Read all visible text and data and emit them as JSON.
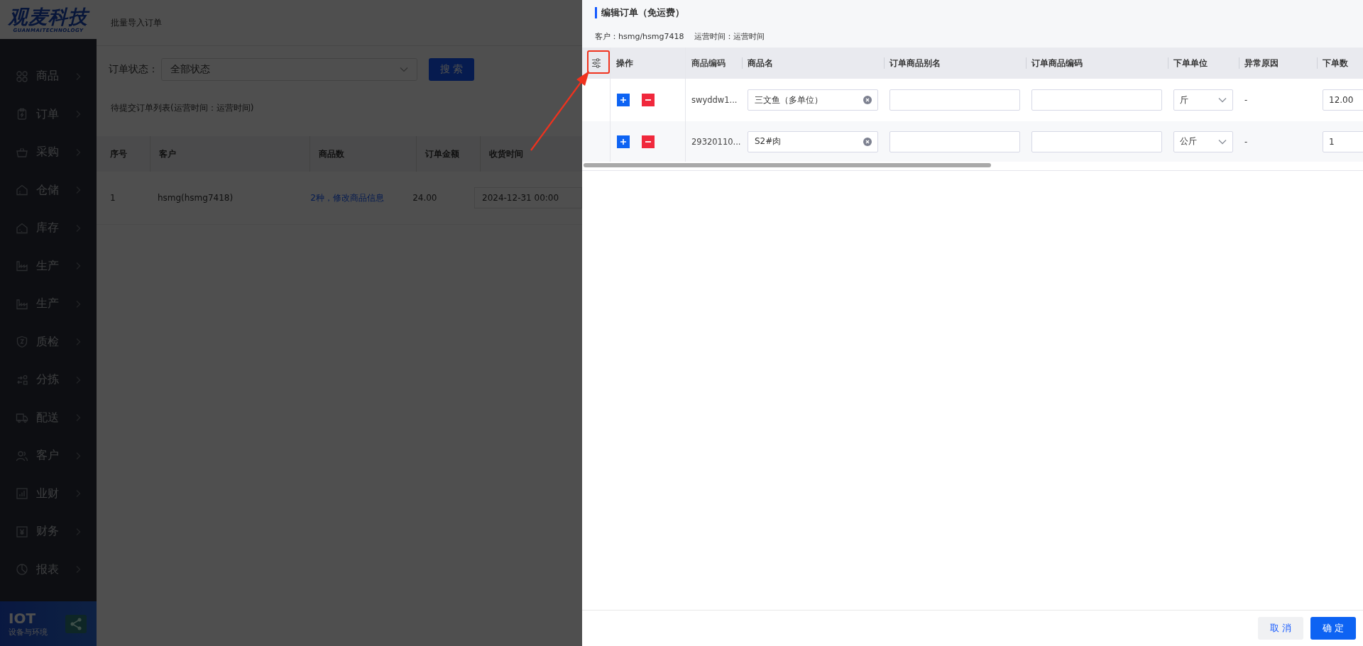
{
  "sidebar": {
    "logo": {
      "title": "观麦科技",
      "subtitle": "GUANMAITECHNOLOGY"
    },
    "items": [
      {
        "label": "商品"
      },
      {
        "label": "订单"
      },
      {
        "label": "采购"
      },
      {
        "label": "仓储"
      },
      {
        "label": "库存"
      },
      {
        "label": "生产"
      },
      {
        "label": "生产"
      },
      {
        "label": "质检"
      },
      {
        "label": "分拣"
      },
      {
        "label": "配送"
      },
      {
        "label": "客户"
      },
      {
        "label": "业财"
      },
      {
        "label": "财务"
      },
      {
        "label": "报表"
      }
    ],
    "promo": {
      "title": "IOT",
      "subtitle": "设备与环境"
    }
  },
  "page": {
    "title": "批量导入订单",
    "filter": {
      "label": "订单状态：",
      "value": "全部状态"
    },
    "search_button": "搜 索",
    "list_title": "待提交订单列表(运营时间：运营时间)",
    "table": {
      "columns": [
        "序号",
        "客户",
        "商品数",
        "订单金额",
        "收货时间"
      ],
      "rows": [
        {
          "index": "1",
          "customer": "hsmg(hsmg7418)",
          "items_link": "2种，修改商品信息",
          "amount": "24.00",
          "delivery_time": "2024-12-31 00:00"
        }
      ]
    }
  },
  "drawer": {
    "title": "编辑订单（免运费）",
    "customer": "客户：hsmg/hsmg7418",
    "operating_time": "运营时间：运营时间",
    "columns": [
      "操作",
      "商品编码",
      "商品名",
      "订单商品别名",
      "订单商品编码",
      "下单单位",
      "异常原因",
      "下单数"
    ],
    "rows": [
      {
        "code": "swyddw1...",
        "name": "三文鱼（多单位）",
        "unit": "斤",
        "reason": "-",
        "quantity": "12.00"
      },
      {
        "code": "29320110...",
        "name": "S2#肉",
        "unit": "公斤",
        "reason": "-",
        "quantity": "1"
      }
    ],
    "buttons": {
      "cancel": "取 消",
      "confirm": "确 定"
    }
  }
}
